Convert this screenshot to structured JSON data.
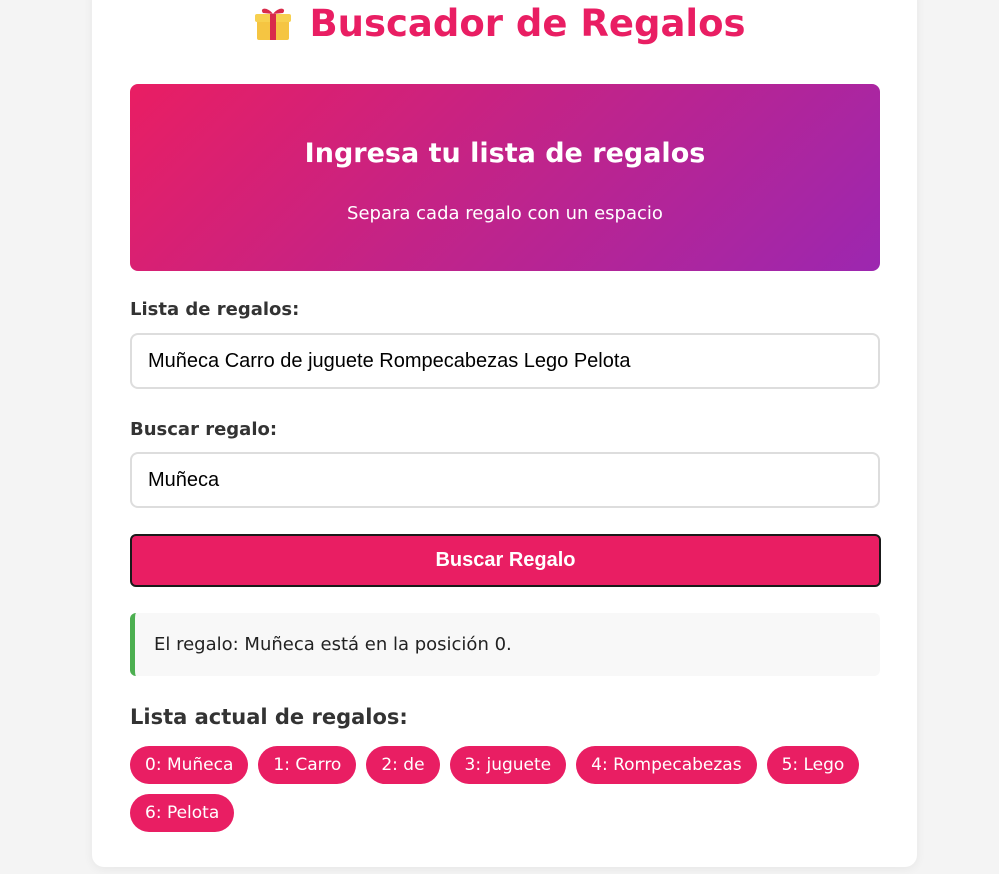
{
  "page": {
    "title": "Buscador de Regalos",
    "title_icon": "gift-icon"
  },
  "banner": {
    "title": "Ingresa tu lista de regalos",
    "subtitle": "Separa cada regalo con un espacio"
  },
  "form": {
    "list_label": "Lista de regalos:",
    "list_value": "Muñeca Carro de juguete Rompecabezas Lego Pelota",
    "search_label": "Buscar regalo:",
    "search_value": "Muñeca",
    "button_label": "Buscar Regalo"
  },
  "result": {
    "message": "El regalo: Muñeca está en la posición 0."
  },
  "current_list": {
    "heading": "Lista actual de regalos:",
    "items": [
      "0: Muñeca",
      "1: Carro",
      "2: de",
      "3: juguete",
      "4: Rompecabezas",
      "5: Lego",
      "6: Pelota"
    ]
  },
  "colors": {
    "accent": "#e91e63",
    "gradient_end": "#9c27b0",
    "success": "#4caf50"
  }
}
